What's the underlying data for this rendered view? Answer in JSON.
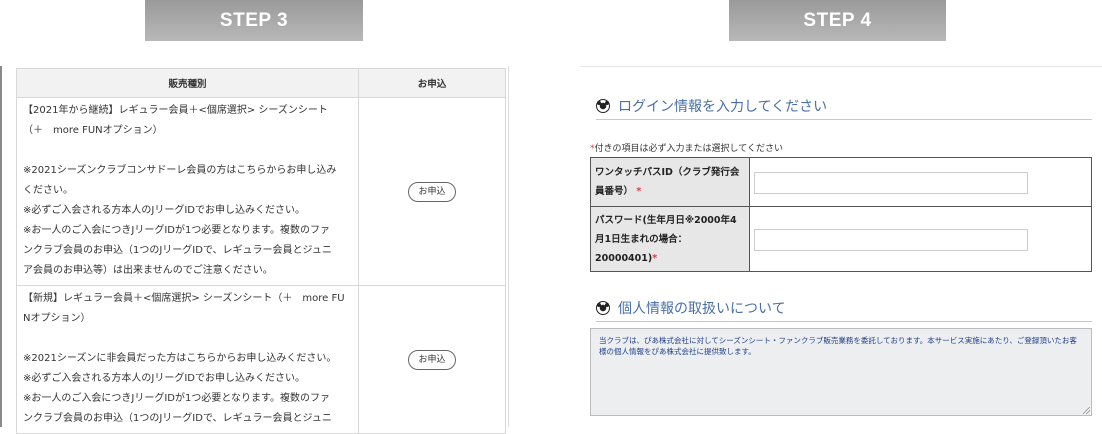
{
  "step3": {
    "title": "STEP 3",
    "table": {
      "headers": [
        "販売種別",
        "お申込"
      ],
      "rows": [
        {
          "lines": [
            "【2021年から継続】レギュラー会員＋<個席選択> シーズンシート",
            "（＋　more FUNオプション）",
            "",
            "※2021シーズンクラブコンサドーレ会員の方はこちらからお申し込み",
            "ください。",
            "※必ずご入会される方本人のJリーグIDでお申し込みください。",
            "※お一人のご入会につきJリーグIDが1つ必要となります。複数のファ",
            "ンクラブ会員のお申込（1つのJリーグIDで、レギュラー会員とジュニ",
            "ア会員のお申込等）は出来ませんのでご注意ください。"
          ],
          "button": "お申込"
        },
        {
          "lines": [
            "【新規】レギュラー会員＋<個席選択> シーズンシート（＋　more FU",
            "Nオプション）",
            "",
            "※2021シーズンに非会員だった方はこちらからお申し込みください。",
            "※必ずご入会される方本人のJリーグIDでお申し込みください。",
            "※お一人のご入会につきJリーグIDが1つ必要となります。複数のファ",
            "ンクラブ会員のお申込（1つのJリーグIDで、レギュラー会員とジュニ"
          ],
          "button": "お申込"
        }
      ]
    }
  },
  "step4": {
    "title": "STEP 4",
    "login_heading": "ログイン情報を入力してください",
    "required_note_mark": "*",
    "required_note": "付きの項目は必ず入力または選択してください",
    "fields": [
      {
        "label": "ワンタッチパスID（クラブ発行会員番号）",
        "required": "*",
        "value": ""
      },
      {
        "label": "パスワード(生年月日※2000年4月1日生まれの場合：20000401)",
        "required": "*",
        "value": ""
      }
    ],
    "privacy_heading": "個人情報の取扱いについて",
    "privacy_text": "当クラブは、ぴあ株式会社に対してシーズンシート・ファンクラブ販売業務を委託しております。本サービス実施にあたり、ご登録頂いたお客様の個人情報をぴあ株式会社に提供致します。"
  }
}
